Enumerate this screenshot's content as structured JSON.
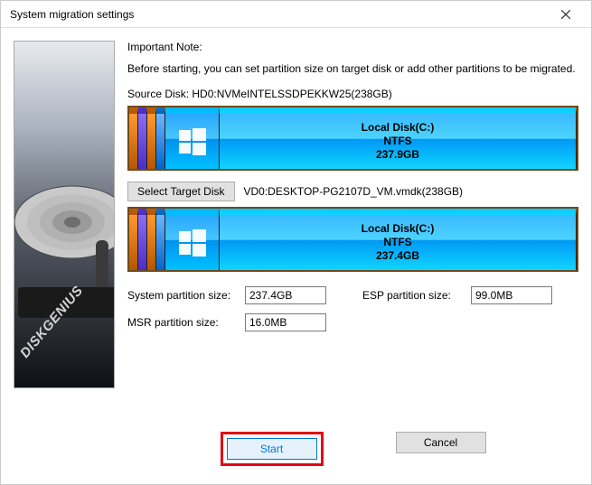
{
  "window": {
    "title": "System migration settings"
  },
  "note": {
    "title": "Important Note:",
    "text": "Before starting, you can set partition size on target disk or add other partitions to be migrated."
  },
  "source": {
    "label": "Source Disk:  HD0:NVMeINTELSSDPEKKW25(238GB)",
    "partition": {
      "name": "Local Disk(C:)",
      "fs": "NTFS",
      "size": "237.9GB"
    }
  },
  "target": {
    "button": "Select Target Disk",
    "label": "VD0:DESKTOP-PG2107D_VM.vmdk(238GB)",
    "partition": {
      "name": "Local Disk(C:)",
      "fs": "NTFS",
      "size": "237.4GB"
    }
  },
  "fields": {
    "system_label": "System partition size:",
    "system_value": "237.4GB",
    "esp_label": "ESP partition size:",
    "esp_value": "99.0MB",
    "msr_label": "MSR partition size:",
    "msr_value": "16.0MB"
  },
  "buttons": {
    "start": "Start",
    "cancel": "Cancel"
  },
  "brand": "DISKGENIUS"
}
